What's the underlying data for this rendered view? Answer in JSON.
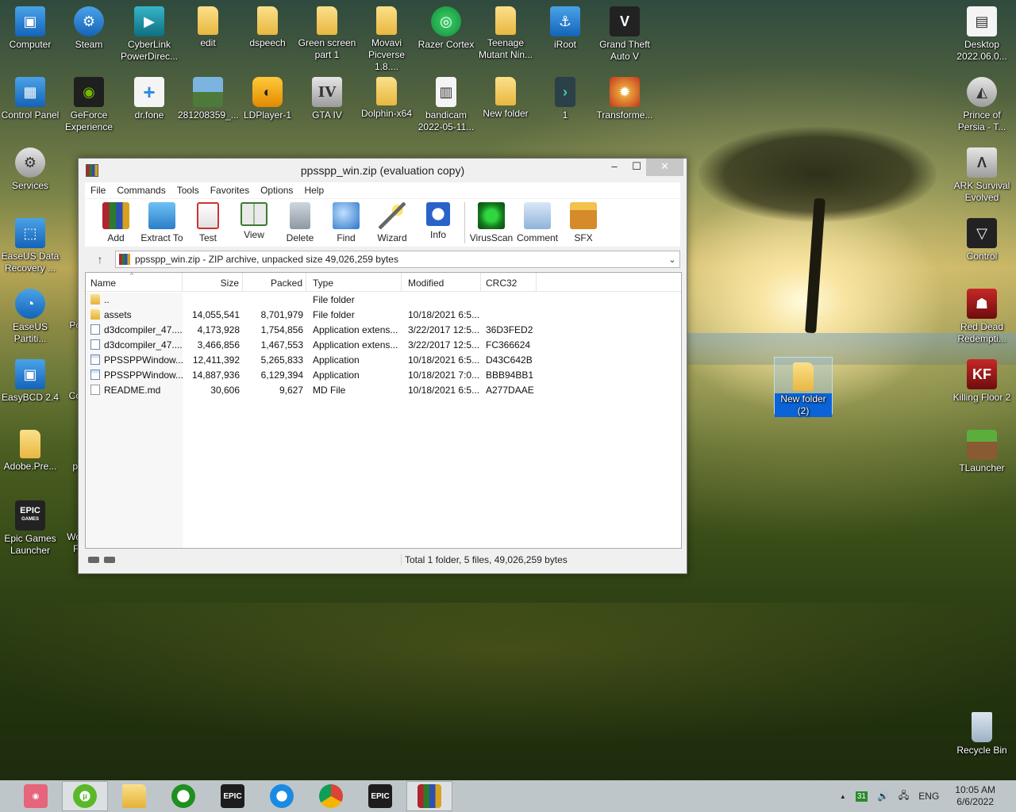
{
  "desktop": {
    "icons": [
      {
        "label": "Computer",
        "icon": "computer-icon"
      },
      {
        "label": "Steam",
        "icon": "steam-icon"
      },
      {
        "label": "CyberLink PowerDirec...",
        "icon": "cyberlink-icon"
      },
      {
        "label": "edit",
        "icon": "folder-icon"
      },
      {
        "label": "dspeech",
        "icon": "folder-icon"
      },
      {
        "label": "Green screen part 1",
        "icon": "folder-icon"
      },
      {
        "label": "Movavi Picverse 1.8....",
        "icon": "folder-icon"
      },
      {
        "label": "Razer Cortex",
        "icon": "razer-icon"
      },
      {
        "label": "Teenage Mutant Nin...",
        "icon": "folder-icon"
      },
      {
        "label": "iRoot",
        "icon": "iroot-icon"
      },
      {
        "label": "Grand Theft Auto V",
        "icon": "gta5-icon"
      },
      {
        "label": "Desktop 2022.06.0...",
        "icon": "file-icon"
      },
      {
        "label": "Control Panel",
        "icon": "control-panel-icon"
      },
      {
        "label": "GeForce Experience",
        "icon": "geforce-icon"
      },
      {
        "label": "dr.fone",
        "icon": "drfone-icon"
      },
      {
        "label": "281208359_...",
        "icon": "image-icon"
      },
      {
        "label": "LDPlayer-1",
        "icon": "ldplayer-icon"
      },
      {
        "label": "GTA IV",
        "icon": "gta4-icon"
      },
      {
        "label": "Dolphin-x64",
        "icon": "folder-icon"
      },
      {
        "label": "bandicam 2022-05-11...",
        "icon": "video-icon"
      },
      {
        "label": "New folder",
        "icon": "folder-icon"
      },
      {
        "label": "1",
        "icon": "file-icon"
      },
      {
        "label": "Transforme...",
        "icon": "transformers-icon"
      },
      {
        "label": "Prince of Persia - T...",
        "icon": "prince-of-persia-icon"
      },
      {
        "label": "Services",
        "icon": "services-icon"
      },
      {
        "label": "ARK Survival Evolved",
        "icon": "ark-icon"
      },
      {
        "label": "EaseUS Data Recovery ...",
        "icon": "easeus-icon"
      },
      {
        "label": "Control",
        "icon": "control-game-icon"
      },
      {
        "label": "EaseUS Partiti...",
        "icon": "easeus-partition-icon"
      },
      {
        "label": "Red Dead Redempti...",
        "icon": "red-dead-icon"
      },
      {
        "label": "EasyBCD 2.4",
        "icon": "easybcd-icon"
      },
      {
        "label": "Killing Floor 2",
        "icon": "killing-floor-icon"
      },
      {
        "label": "TLauncher",
        "icon": "tlauncher-icon"
      },
      {
        "label": "Adobe.Pre...",
        "icon": "folder-icon"
      },
      {
        "label": "Epic Games Launcher",
        "icon": "epic-games-icon"
      },
      {
        "label": "Recycle Bin",
        "icon": "recycle-bin-icon"
      },
      {
        "label": "New folder (2)",
        "icon": "folder-icon"
      }
    ],
    "partial_labels": [
      "G",
      "C",
      "Po",
      "Co",
      "pr",
      "f",
      "Wo",
      "Fi"
    ],
    "epic_text": "EPIC",
    "epic_sub": "GAMES",
    "gta_v": "V",
    "gta_iv": "IV",
    "drfone_plus": "+",
    "kf2_text": "KF"
  },
  "window": {
    "title": "ppsspp_win.zip (evaluation copy)",
    "controls": {
      "minimize": "–",
      "maximize": "☐",
      "close": "✕"
    },
    "menu": [
      "File",
      "Commands",
      "Tools",
      "Favorites",
      "Options",
      "Help"
    ],
    "toolbar": [
      {
        "label": "Add",
        "icon": "add-archive-icon"
      },
      {
        "label": "Extract To",
        "icon": "extract-to-icon"
      },
      {
        "label": "Test",
        "icon": "test-icon"
      },
      {
        "label": "View",
        "icon": "view-icon"
      },
      {
        "label": "Delete",
        "icon": "delete-icon"
      },
      {
        "label": "Find",
        "icon": "find-icon"
      },
      {
        "label": "Wizard",
        "icon": "wizard-icon"
      },
      {
        "label": "Info",
        "icon": "info-icon"
      },
      {
        "label": "VirusScan",
        "icon": "virusscan-icon"
      },
      {
        "label": "Comment",
        "icon": "comment-icon"
      },
      {
        "label": "SFX",
        "icon": "sfx-icon"
      }
    ],
    "up_arrow": "↑",
    "address": "ppsspp_win.zip - ZIP archive, unpacked size 49,026,259 bytes",
    "address_dropdown": "⌄",
    "columns": {
      "name": "Name",
      "size": "Size",
      "packed": "Packed",
      "type": "Type",
      "modified": "Modified",
      "crc": "CRC32"
    },
    "sort_indicator": "^",
    "files": [
      {
        "name": "..",
        "size": "",
        "packed": "",
        "type": "File folder",
        "modified": "",
        "crc": "",
        "kind": "folder"
      },
      {
        "name": "assets",
        "size": "14,055,541",
        "packed": "8,701,979",
        "type": "File folder",
        "modified": "10/18/2021 6:5...",
        "crc": "",
        "kind": "folder"
      },
      {
        "name": "d3dcompiler_47....",
        "size": "4,173,928",
        "packed": "1,754,856",
        "type": "Application extens...",
        "modified": "3/22/2017 12:5...",
        "crc": "36D3FED2",
        "kind": "dll"
      },
      {
        "name": "d3dcompiler_47....",
        "size": "3,466,856",
        "packed": "1,467,553",
        "type": "Application extens...",
        "modified": "3/22/2017 12:5...",
        "crc": "FC366624",
        "kind": "dll"
      },
      {
        "name": "PPSSPPWindow...",
        "size": "12,411,392",
        "packed": "5,265,833",
        "type": "Application",
        "modified": "10/18/2021 6:5...",
        "crc": "D43C642B",
        "kind": "exe"
      },
      {
        "name": "PPSSPPWindow...",
        "size": "14,887,936",
        "packed": "6,129,394",
        "type": "Application",
        "modified": "10/18/2021 7:0...",
        "crc": "BBB94BB1",
        "kind": "exe"
      },
      {
        "name": "README.md",
        "size": "30,606",
        "packed": "9,627",
        "type": "MD File",
        "modified": "10/18/2021 6:5...",
        "crc": "A277DAAE",
        "kind": "md"
      }
    ],
    "status": "Total 1 folder, 5 files, 49,026,259 bytes"
  },
  "taskbar": {
    "apps": [
      {
        "name": "screen-recorder",
        "icon": "recorder-icon"
      },
      {
        "name": "utorrent",
        "icon": "utorrent-icon"
      },
      {
        "name": "file-explorer",
        "icon": "file-explorer-icon"
      },
      {
        "name": "xbox",
        "icon": "xbox-icon"
      },
      {
        "name": "epic-games",
        "icon": "epic-games-icon"
      },
      {
        "name": "internet-explorer",
        "icon": "ie-icon"
      },
      {
        "name": "chrome",
        "icon": "chrome-icon"
      },
      {
        "name": "epic-games-2",
        "icon": "epic-games-icon"
      },
      {
        "name": "winrar",
        "icon": "winrar-icon"
      }
    ],
    "active": [
      1,
      8
    ],
    "tray": {
      "chevron": "▲",
      "calendar_badge": "31",
      "volume": "🔊",
      "network": "🖧",
      "language": "ENG"
    },
    "clock": {
      "time": "10:05 AM",
      "date": "6/6/2022"
    }
  }
}
